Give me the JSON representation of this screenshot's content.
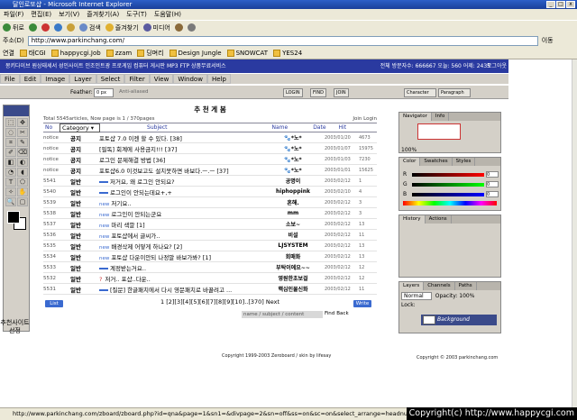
{
  "window": {
    "title": "달인로또샵 - Microsoft Internet Explorer",
    "controls": [
      "_",
      "□",
      "x"
    ]
  },
  "menu": [
    "파일(F)",
    "편집(E)",
    "보기(V)",
    "즐겨찾기(A)",
    "도구(T)",
    "도움말(H)"
  ],
  "toolbar": {
    "back": "뒤로",
    "search": "검색",
    "favorites": "즐겨찾기",
    "media": "미디어"
  },
  "address": {
    "label": "주소(D)",
    "url": "http://www.parkinchang.com/",
    "go": "이동"
  },
  "links": {
    "label": "연결",
    "items": [
      "태CGI",
      "happycgi.Job",
      "zzam",
      "딩며리",
      "Design Jungle",
      "SNOWCAT",
      "YES24"
    ]
  },
  "site": {
    "nav": "몽키다이브 원상태세서 성인사이트 인조인트광 프로게임 컴퓨터 게시판 MP3 FTP 상품무료서비스",
    "stats": "전체 방문자수: 666667 오늘: 560 어제: 2435",
    "logout": "로그아웃"
  },
  "ps": {
    "menu": [
      "File",
      "Edit",
      "Image",
      "Layer",
      "Select",
      "Filter",
      "View",
      "Window",
      "Help"
    ],
    "opts": {
      "feather_label": "Feather:",
      "feather": "0 px",
      "anti": "Anti-aliased",
      "btns": [
        "LOGIN",
        "FIND",
        "JOIN"
      ]
    },
    "tools": [
      "⬚",
      "✥",
      "◌",
      "✂",
      "⌗",
      "✎",
      "✐",
      "⌫",
      "◧",
      "◐",
      "◔",
      "◖",
      "T",
      "⬠",
      "✧",
      "✋",
      "🔍",
      "▢"
    ],
    "side_label": "추천사이트\n선정"
  },
  "board": {
    "title": "추 천 게 봄",
    "total": "Total 5545articles, Now page is 1 / 370pages",
    "login": "Join Login",
    "head": {
      "no": "No",
      "category": "Category",
      "subject": "Subject",
      "name": "Name",
      "date": "Date",
      "hit": "Hit"
    },
    "rows": [
      {
        "no": "notice",
        "kind": "공지",
        "subject": "포토샵 7.0 이젠 할 수 있다. [38]",
        "new": false,
        "name": "🐾*노*",
        "date": "2003/01/20",
        "hit": "4673"
      },
      {
        "no": "notice",
        "kind": "공지",
        "subject": "[필독] 회계에 사용금지!!! [37]",
        "new": false,
        "name": "🐾*노*",
        "date": "2003/01/07",
        "hit": "15975"
      },
      {
        "no": "notice",
        "kind": "공지",
        "subject": "로그인 문제해결 방법 [36]",
        "new": false,
        "name": "🐾*노*",
        "date": "2003/01/03",
        "hit": "7230"
      },
      {
        "no": "notice",
        "kind": "공지",
        "subject": "포토샵6.0 이것보고도 설치못하면 바보다.ㅡ.ㅡ [37]",
        "new": false,
        "name": "🐾*노*",
        "date": "2003/01/01",
        "hit": "15625"
      },
      {
        "no": "5541",
        "kind": "일반",
        "subject": "저거요, 왜 로그인 안되요?",
        "new": false,
        "bar": true,
        "name": "공명이",
        "date": "2003/02/12",
        "hit": "1"
      },
      {
        "no": "5540",
        "kind": "일반",
        "subject": "로그인이 안되는데요+,+",
        "new": false,
        "bar": true,
        "name": "hiphoppink",
        "date": "2003/02/10",
        "hit": "4"
      },
      {
        "no": "5539",
        "kind": "일반",
        "subject": "저기요..",
        "new": true,
        "name": "혼해.",
        "date": "2003/02/12",
        "hit": "3"
      },
      {
        "no": "5538",
        "kind": "일반",
        "subject": "로그인이 안되는군요",
        "new": true,
        "name": "mm",
        "date": "2003/02/12",
        "hit": "3"
      },
      {
        "no": "5537",
        "kind": "일반",
        "subject": "마리 색깔 [1]",
        "new": true,
        "name": "소보~",
        "date": "2003/02/12",
        "hit": "13"
      },
      {
        "no": "5536",
        "kind": "일반",
        "subject": "포토샵에서 글씨가..",
        "new": true,
        "name": "비설",
        "date": "2003/02/12",
        "hit": "11"
      },
      {
        "no": "5535",
        "kind": "일반",
        "subject": "배경삭제 어떻게 하나요? [2]",
        "new": true,
        "name": "LJSYSTEM",
        "date": "2003/02/12",
        "hit": "13"
      },
      {
        "no": "5534",
        "kind": "일반",
        "subject": "포토샵 다운이안되 나정말 바보가봐? [1]",
        "new": true,
        "name": "회매화",
        "date": "2003/02/12",
        "hit": "13"
      },
      {
        "no": "5533",
        "kind": "일반",
        "subject": "계정받는거요..",
        "new": false,
        "bar": true,
        "name": "부탁이에요~~",
        "date": "2003/02/12",
        "hit": "12"
      },
      {
        "no": "5532",
        "kind": "일반",
        "subject": "저거.. 포샵..다운..",
        "new": false,
        "q": true,
        "name": "영원한초보걸",
        "date": "2003/02/12",
        "hit": "12"
      },
      {
        "no": "5531",
        "kind": "일반",
        "subject": "[질문] 한글패치에서 다시 영문패치로 바꿀려고 ...",
        "new": false,
        "bar": true,
        "name": "핵심인물신화",
        "date": "2003/02/12",
        "hit": "11"
      }
    ],
    "list_btn": "List",
    "write_btn": "Write",
    "pages": "1 [2][3][4][5][6][7][8][9][10]..[370] Next",
    "search_placeholder": "name / subject / content",
    "find": "Find",
    "back": "Back",
    "copyright": "Copyright 1999-2003 Zeroboard / skin by lifesay"
  },
  "panels": {
    "navigator": [
      "Navigator",
      "Info"
    ],
    "zoom": "100%",
    "color": [
      "Color",
      "Swatches",
      "Styles"
    ],
    "rgb": [
      {
        "c": "R",
        "v": "0"
      },
      {
        "c": "G",
        "v": "0"
      },
      {
        "c": "B",
        "v": "0"
      }
    ],
    "history": [
      "History",
      "Actions"
    ],
    "layers": [
      "Layers",
      "Channels",
      "Paths"
    ],
    "blend": "Normal",
    "opacity": "Opacity: 100%",
    "lock": "Lock:",
    "layer_name": "Background",
    "char": [
      "Character",
      "Paragraph"
    ],
    "copyright": "Copyright © 2003 parkinchang.com"
  },
  "status": {
    "url": "http://www.parkinchang.com/zboard/zboard.php?id=qna&page=1&sn1=&divpage=2&sn=off&ss=on&sc=on&select_arrange=headnum&desc=asc&no=5531"
  },
  "watermark": "Copyright(c) http://www.happycgi.com"
}
